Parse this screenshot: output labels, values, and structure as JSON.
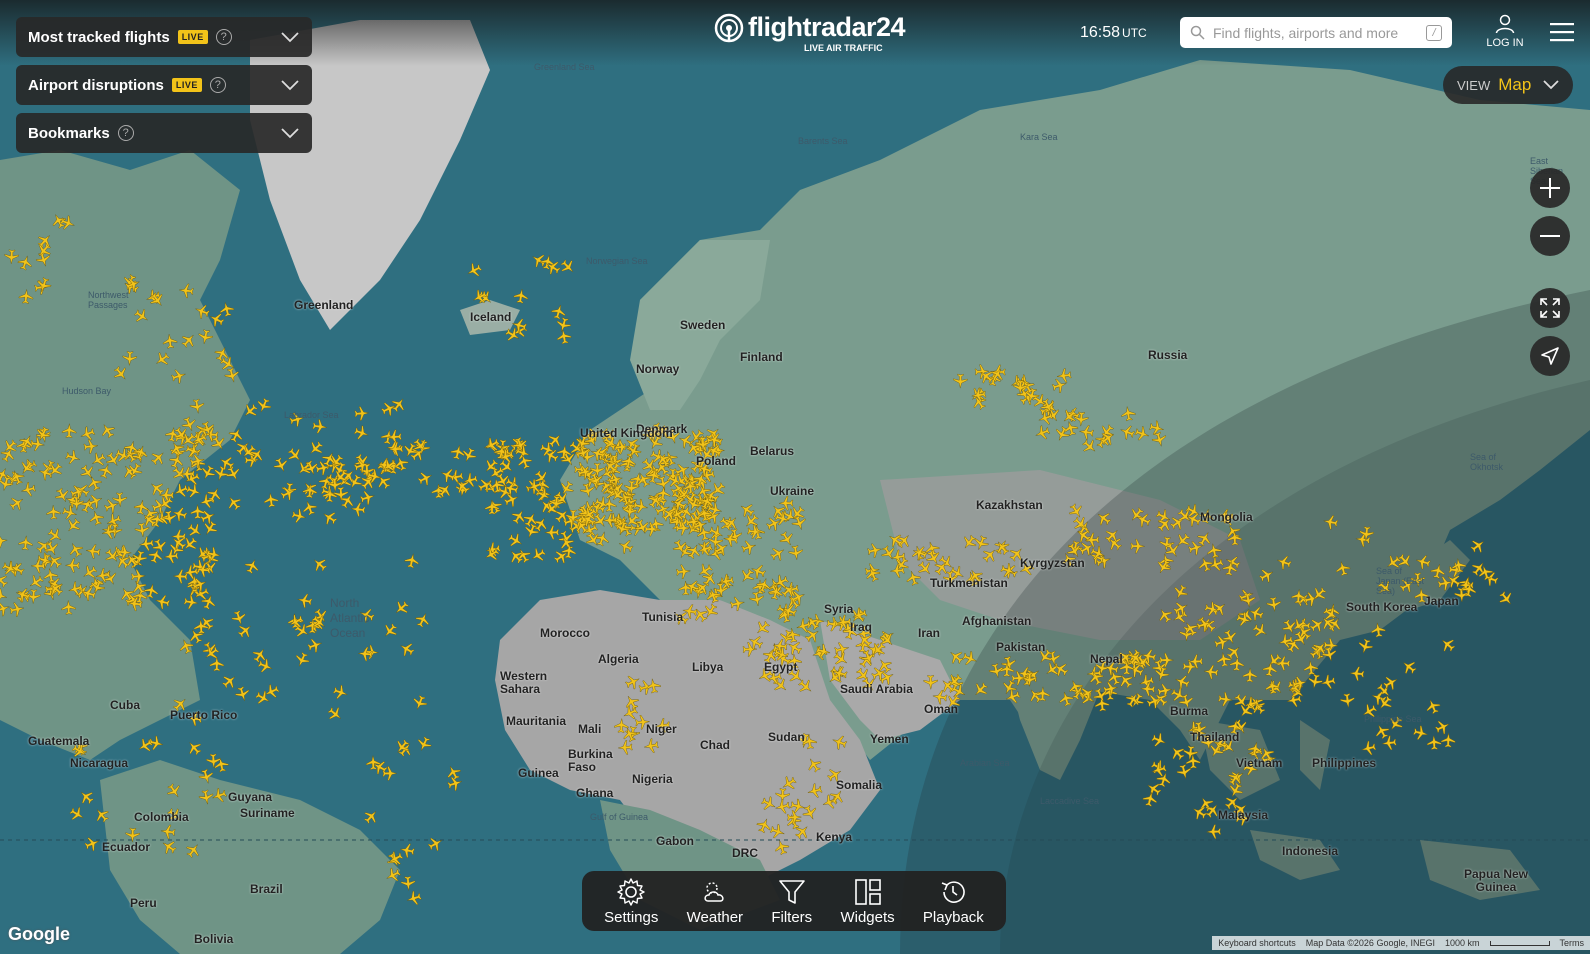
{
  "panels": {
    "tracked": {
      "label": "Most tracked flights",
      "badge": "LIVE"
    },
    "disruptions": {
      "label": "Airport disruptions",
      "badge": "LIVE"
    },
    "bookmarks": {
      "label": "Bookmarks"
    }
  },
  "header": {
    "logo": "flightradar24",
    "logo_sub": "LIVE AIR TRAFFIC",
    "time": "16:58",
    "timezone": "UTC",
    "search_placeholder": "Find flights, airports and more",
    "search_shortcut": "/",
    "login_label": "LOG IN"
  },
  "view": {
    "label": "VIEW",
    "value": "Map"
  },
  "toolbar": [
    {
      "label": "Settings",
      "icon": "gear-icon"
    },
    {
      "label": "Weather",
      "icon": "weather-icon"
    },
    {
      "label": "Filters",
      "icon": "filter-icon"
    },
    {
      "label": "Widgets",
      "icon": "widgets-icon"
    },
    {
      "label": "Playback",
      "icon": "playback-icon"
    }
  ],
  "map": {
    "brand": "Google",
    "attribution": [
      "Keyboard shortcuts",
      "Map Data ©2026 Google, INEGI",
      "1000 km",
      "Terms"
    ],
    "colors": {
      "ocean": "#2d6a7c",
      "land": "#7a9c8e",
      "desert": "#a8a8a8",
      "aircraft": "#f2c319"
    },
    "countries": [
      "Greenland",
      "Iceland",
      "Sweden",
      "Finland",
      "Norway",
      "Russia",
      "Denmark",
      "United Kingdom",
      "Poland",
      "Belarus",
      "Ukraine",
      "Kazakhstan",
      "Mongolia",
      "Tunisia",
      "Morocco",
      "Algeria",
      "Libya",
      "Egypt",
      "Western Sahara",
      "Mauritania",
      "Mali",
      "Niger",
      "Chad",
      "Sudan",
      "Burkina Faso",
      "Nigeria",
      "Guinea",
      "Ghana",
      "Gabon",
      "DRC",
      "Syria",
      "Iraq",
      "Iran",
      "Afghanistan",
      "Turkmenistan",
      "Kyrgyzstan",
      "Pakistan",
      "Nepal",
      "Yemen",
      "Oman",
      "Saudi Arabia",
      "Burma",
      "Thailand",
      "Vietnam",
      "Philippines",
      "Malaysia",
      "Indonesia",
      "Papua New Guinea",
      "Japan",
      "South Korea",
      "Kenya",
      "Somalia",
      "Guatemala",
      "Nicaragua",
      "Colombia",
      "Ecuador",
      "Peru",
      "Brazil",
      "Bolivia",
      "Guyana",
      "Suriname",
      "Cuba",
      "Puerto Rico"
    ],
    "seas": [
      "Greenland Sea",
      "Barents Sea",
      "Kara Sea",
      "Norwegian Sea",
      "Hudson Bay",
      "Labrador Sea",
      "North Atlantic Ocean",
      "Northwest Passages",
      "Sea of Okhotsk",
      "Sea of Japan (East Sea)",
      "Arabian Sea",
      "Gulf of Guinea",
      "Laccadive Sea",
      "Philippine Sea",
      "East Siberian Sea"
    ]
  }
}
